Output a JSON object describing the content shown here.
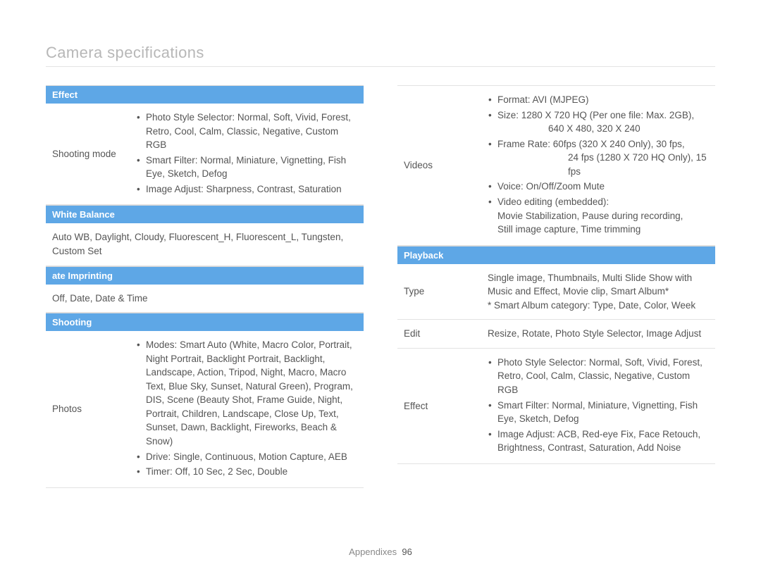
{
  "page": {
    "title": "Camera specifications",
    "footer_label": "Appendixes",
    "footer_page": "96"
  },
  "left": {
    "effect": {
      "header": "Effect",
      "row_label": "Shooting mode",
      "bullets": [
        "Photo Style Selector: Normal, Soft, Vivid, Forest, Retro, Cool, Calm, Classic, Negative, Custom RGB",
        "Smart Filter: Normal, Miniature, Vignetting, Fish Eye, Sketch, Defog",
        "Image Adjust: Sharpness, Contrast, Saturation"
      ]
    },
    "wb": {
      "header": "White Balance",
      "text": "Auto WB, Daylight, Cloudy, Fluorescent_H, Fluorescent_L, Tungsten, Custom Set"
    },
    "di": {
      "header": "ate Imprinting",
      "text": "Off, Date, Date & Time"
    },
    "shooting": {
      "header": "Shooting",
      "row_label": "Photos",
      "bullets": [
        "Modes: Smart Auto (White, Macro Color, Portrait, Night Portrait, Backlight Portrait, Backlight, Landscape, Action, Tripod, Night, Macro, Macro Text, Blue Sky, Sunset, Natural Green), Program, DIS, Scene (Beauty Shot, Frame Guide, Night, Portrait, Children, Landscape, Close Up, Text, Sunset, Dawn, Backlight, Fireworks, Beach & Snow)",
        "Drive: Single, Continuous, Motion Capture, AEB",
        "Timer: Off, 10 Sec, 2 Sec, Double"
      ]
    }
  },
  "right": {
    "videos": {
      "row_label": "Videos",
      "b1": "Format: AVI (MJPEG)",
      "b2": "Size: 1280 X 720 HQ (Per one file: Max. 2GB),",
      "b2_sub": "640 X 480, 320 X 240",
      "b3": "Frame Rate: 60fps (320 X 240 Only), 30 fps,",
      "b3_sub": "24 fps (1280 X 720 HQ Only), 15 fps",
      "b4": "Voice: On/Off/Zoom Mute",
      "b5": "Video editing (embedded):",
      "b5_sub1": "Movie Stabilization, Pause during recording,",
      "b5_sub2": "Still image capture, Time trimming"
    },
    "playback": {
      "header": "Playback",
      "type_label": "Type",
      "type_text": "Single image, Thumbnails, Multi Slide Show with Music and Effect, Movie clip, Smart Album*\n* Smart Album category: Type, Date, Color, Week",
      "edit_label": "Edit",
      "edit_text": "Resize, Rotate, Photo Style Selector, Image Adjust",
      "effect_label": "Effect",
      "effect_bullets": [
        "Photo Style Selector: Normal, Soft, Vivid, Forest, Retro, Cool, Calm, Classic, Negative, Custom RGB",
        "Smart Filter: Normal, Miniature, Vignetting, Fish Eye, Sketch, Defog",
        "Image Adjust: ACB, Red-eye Fix, Face Retouch, Brightness, Contrast, Saturation, Add Noise"
      ]
    }
  }
}
